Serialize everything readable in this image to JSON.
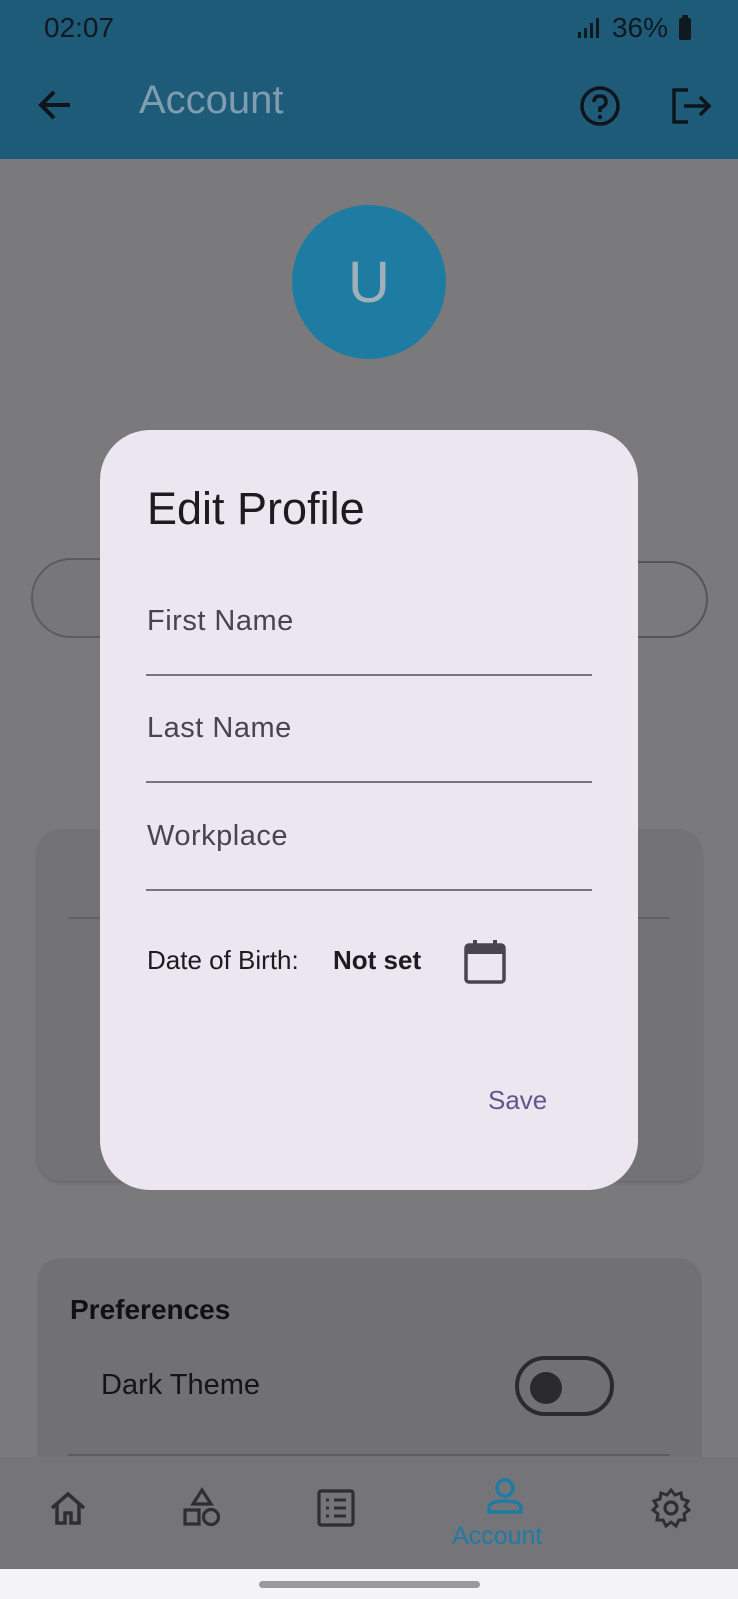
{
  "status_bar": {
    "time": "02:07",
    "battery": "36%"
  },
  "app_bar": {
    "title": "Account"
  },
  "profile": {
    "avatar_initial": "U"
  },
  "preferences": {
    "title": "Preferences",
    "dark_theme_label": "Dark Theme",
    "dark_theme_on": false
  },
  "bottom_nav": {
    "items": [
      {
        "icon": "home-icon"
      },
      {
        "icon": "shapes-icon"
      },
      {
        "icon": "list-icon"
      },
      {
        "icon": "account-icon",
        "label": "Account",
        "selected": true
      },
      {
        "icon": "settings-icon"
      }
    ]
  },
  "dialog": {
    "title": "Edit Profile",
    "first_name_label": "First Name",
    "last_name_label": "Last Name",
    "workplace_label": "Workplace",
    "dob_label": "Date of Birth:",
    "dob_value": "Not set",
    "save_label": "Save"
  },
  "colors": {
    "app_bar": "#2a8ab8",
    "accent": "#1e7ca2",
    "dialog_bg": "#ece6f0",
    "save_text": "#65558f"
  }
}
